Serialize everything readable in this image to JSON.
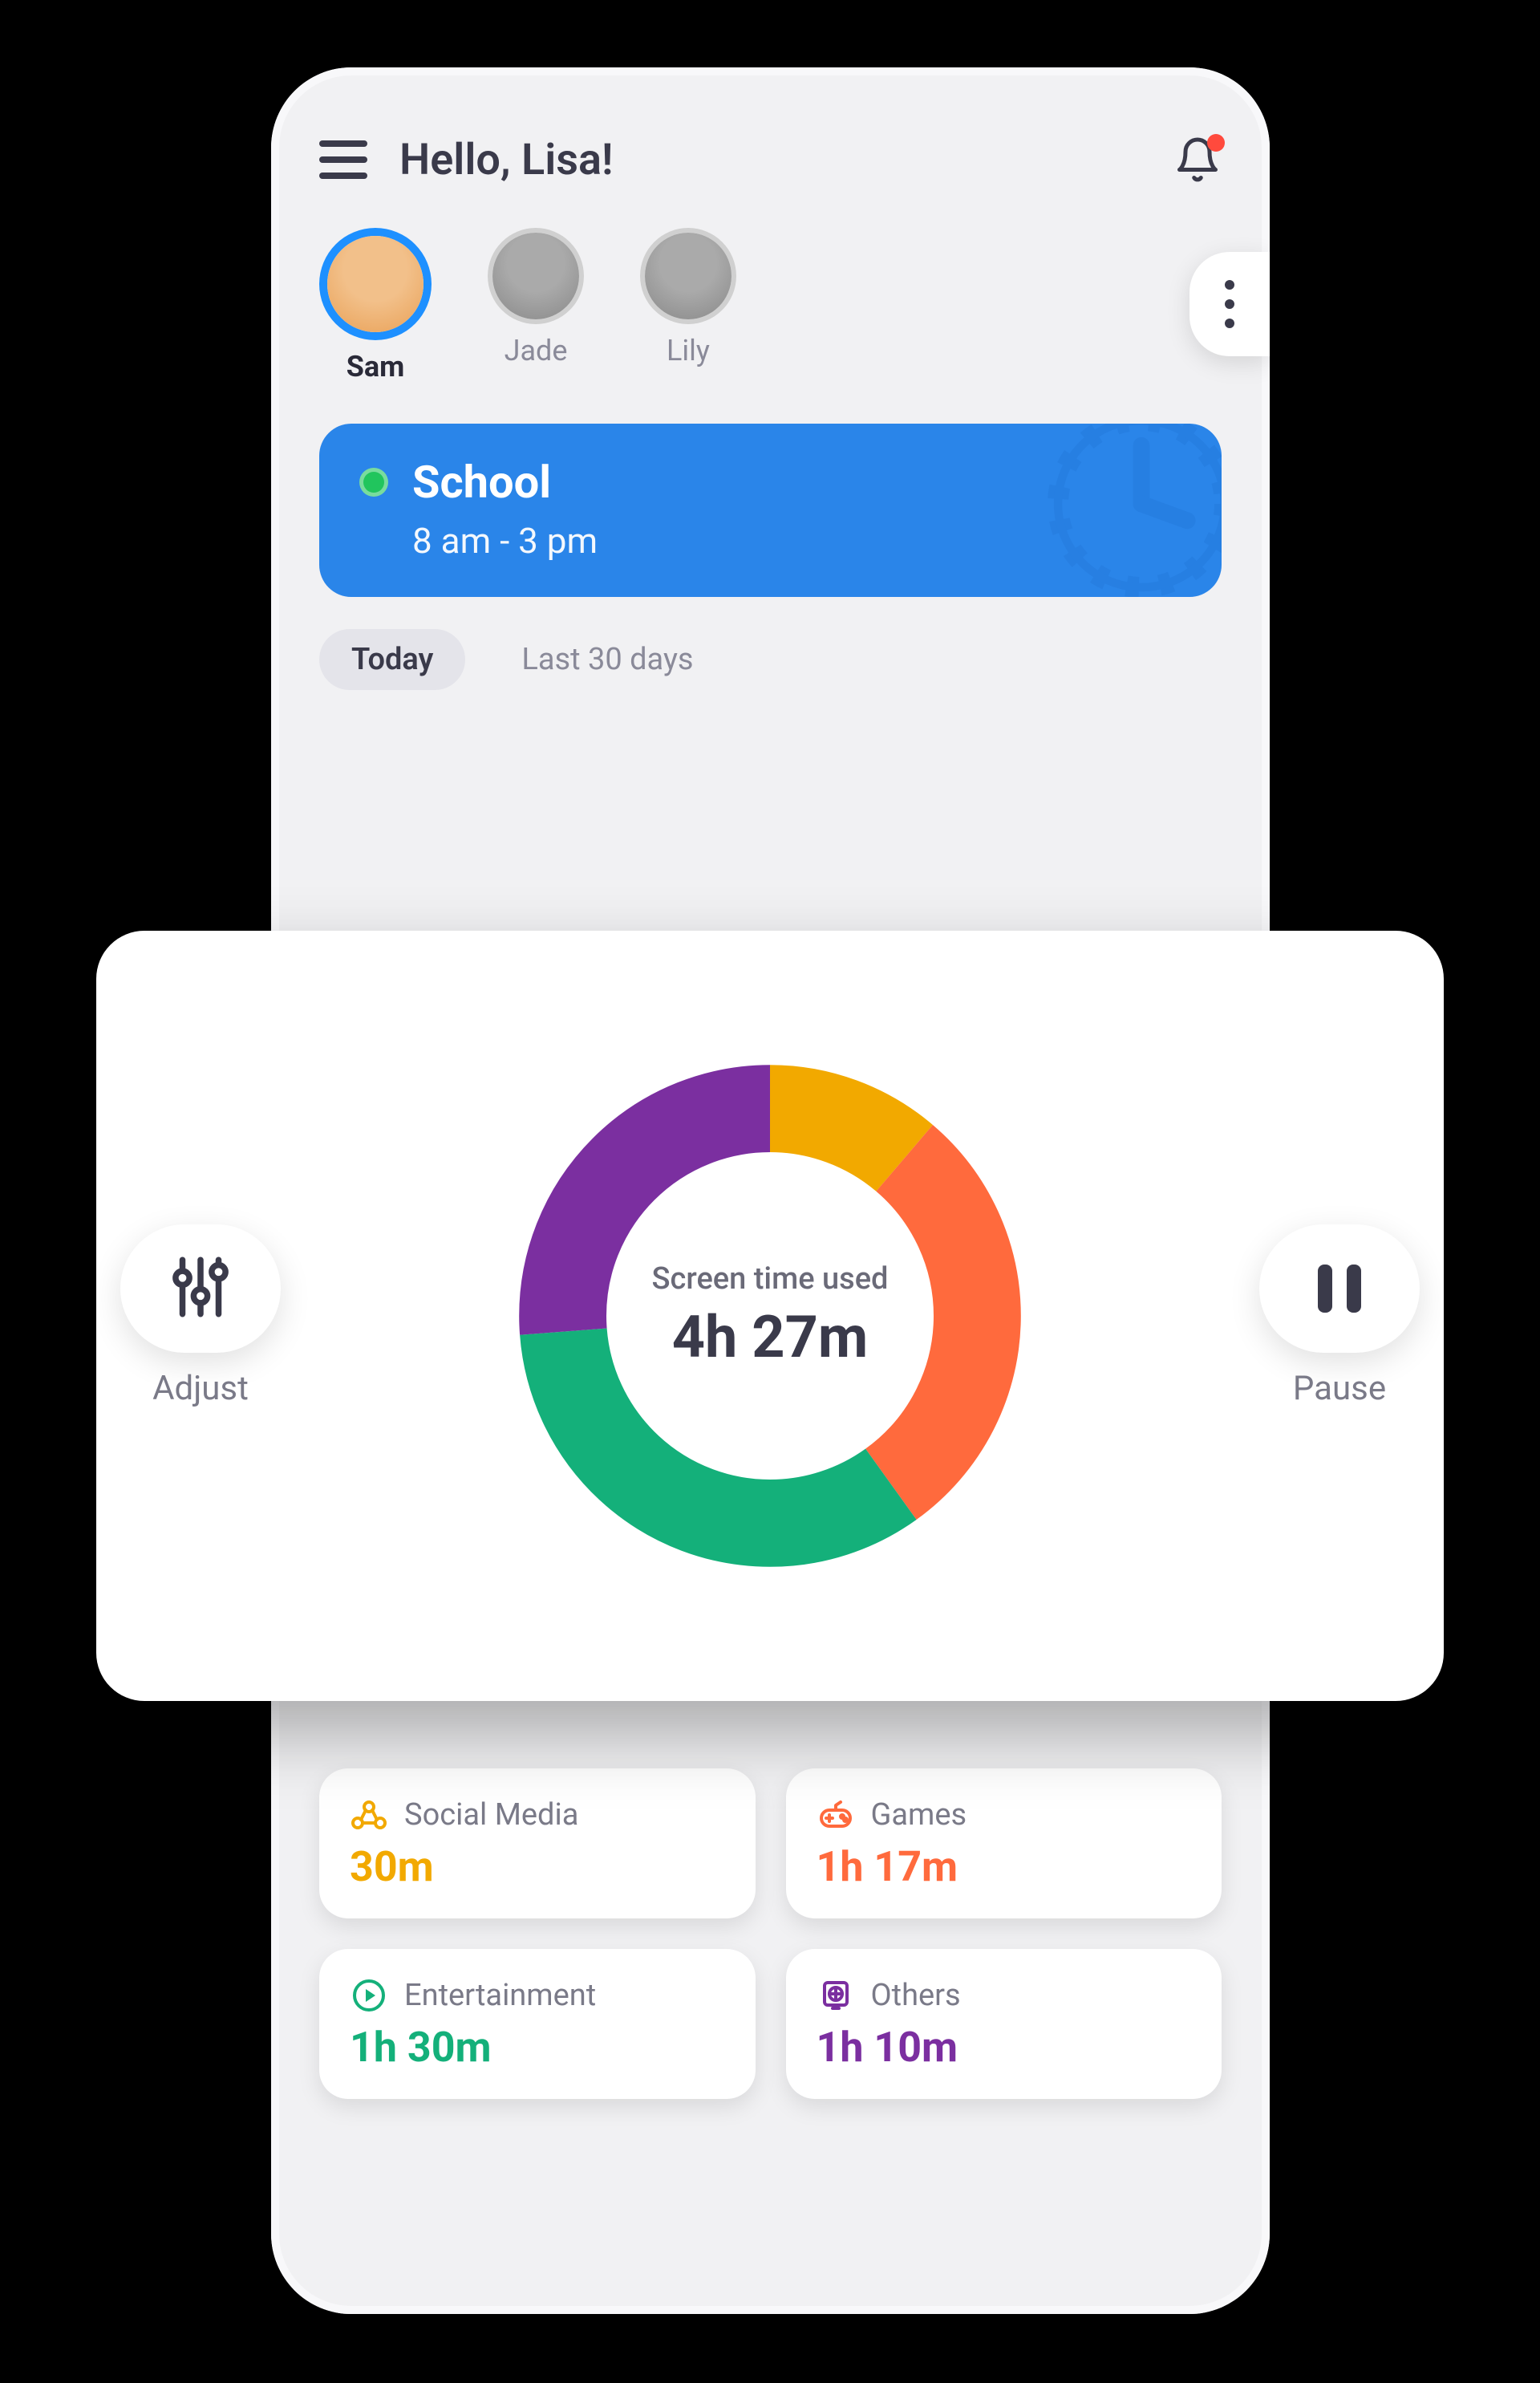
{
  "header": {
    "greeting": "Hello, Lisa!"
  },
  "profiles": [
    {
      "name": "Sam",
      "active": true
    },
    {
      "name": "Jade",
      "active": false
    },
    {
      "name": "Lily",
      "active": false
    }
  ],
  "routine": {
    "title": "School",
    "time": "8 am - 3 pm"
  },
  "tabs": {
    "today": "Today",
    "last30": "Last 30 days"
  },
  "screen_time": {
    "label": "Screen time used",
    "value": "4h 27m",
    "adjust_label": "Adjust",
    "pause_label": "Pause"
  },
  "categories": {
    "social": {
      "name": "Social Media",
      "value": "30m",
      "color": "#f2a900"
    },
    "games": {
      "name": "Games",
      "value": "1h 17m",
      "color": "#ff6a3d"
    },
    "entertainment": {
      "name": "Entertainment",
      "value": "1h 30m",
      "color": "#14b07a"
    },
    "others": {
      "name": "Others",
      "value": "1h 10m",
      "color": "#7b2fa0"
    }
  },
  "chart_data": {
    "type": "pie",
    "title": "Screen time used",
    "total_label": "4h 27m",
    "series": [
      {
        "name": "Social Media",
        "minutes": 30,
        "color": "#f2a900"
      },
      {
        "name": "Games",
        "minutes": 77,
        "color": "#ff6a3d"
      },
      {
        "name": "Entertainment",
        "minutes": 90,
        "color": "#14b07a"
      },
      {
        "name": "Others",
        "minutes": 70,
        "color": "#7b2fa0"
      }
    ]
  }
}
